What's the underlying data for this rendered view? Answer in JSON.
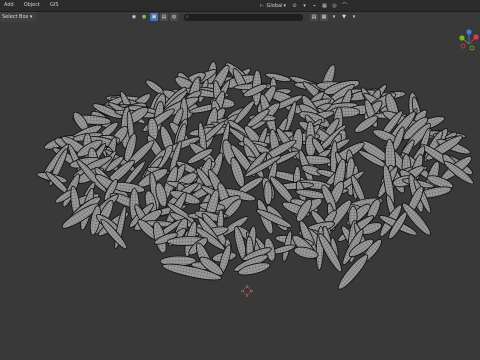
{
  "menubar": {
    "items": [
      "Add",
      "Object",
      "GIS"
    ]
  },
  "header": {
    "transform_orientation": "Global",
    "pivot_icon": "pivot-icon",
    "snap_icon": "snap-icon",
    "proportional_icon": "proportional-edit-icon"
  },
  "toolbar": {
    "select_mode": "Select Box ▾",
    "search_placeholder": "",
    "view_icons": [
      "camera-icon",
      "globe-icon",
      "eye-icon"
    ],
    "right_tool_icons": [
      "table-icon",
      "grid-icon",
      "filter-icon"
    ]
  },
  "gizmo": {
    "axes": [
      "X",
      "Y",
      "Z"
    ],
    "colors": {
      "x": "#e0384b",
      "y": "#6fb62c",
      "z": "#3f7fe0"
    }
  },
  "colors": {
    "background": "#393939",
    "grain_fill": "#9a9a9a",
    "grain_wire": "#1a1a1a",
    "grain_highlight": "#bdbdbd",
    "cursor": "#d04848"
  }
}
